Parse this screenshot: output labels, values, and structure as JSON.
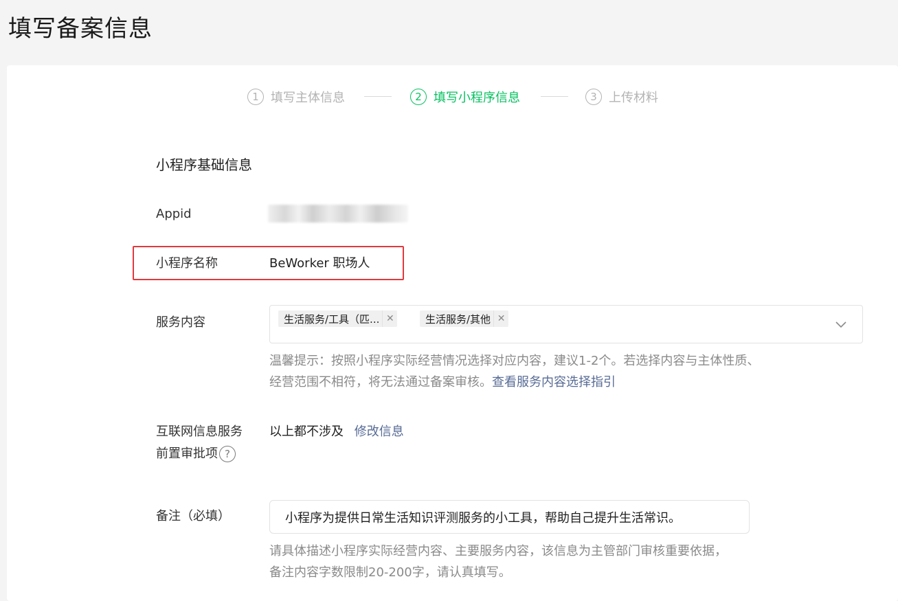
{
  "page": {
    "title": "填写备案信息"
  },
  "steps": [
    {
      "num": "1",
      "label": "填写主体信息",
      "active": false
    },
    {
      "num": "2",
      "label": "填写小程序信息",
      "active": true
    },
    {
      "num": "3",
      "label": "上传材料",
      "active": false
    }
  ],
  "section": {
    "title": "小程序基础信息"
  },
  "appid": {
    "label": "Appid"
  },
  "name": {
    "label": "小程序名称",
    "value": "BeWorker 职场人"
  },
  "service": {
    "label": "服务内容",
    "tags": [
      "生活服务/工具（匹...",
      "生活服务/其他"
    ],
    "hint": "温馨提示：按照小程序实际经营情况选择对应内容，建议1-2个。若选择内容与主体性质、经营范围不相符，将无法通过备案审核。",
    "hint_link": "查看服务内容选择指引"
  },
  "approval": {
    "label_line1": "互联网信息服务",
    "label_line2": "前置审批项",
    "value": "以上都不涉及",
    "edit_link": "修改信息"
  },
  "remark": {
    "label": "备注（必填）",
    "value": "小程序为提供日常生活知识评测服务的小工具，帮助自己提升生活常识。",
    "hint_line1": "请具体描述小程序实际经营内容、主要服务内容，该信息为主管部门审核重要依据，",
    "hint_line2": "备注内容字数限制20-200字，请认真填写。"
  },
  "colors": {
    "accent": "#07c160",
    "link": "#576b95",
    "highlight": "#e0393e"
  }
}
